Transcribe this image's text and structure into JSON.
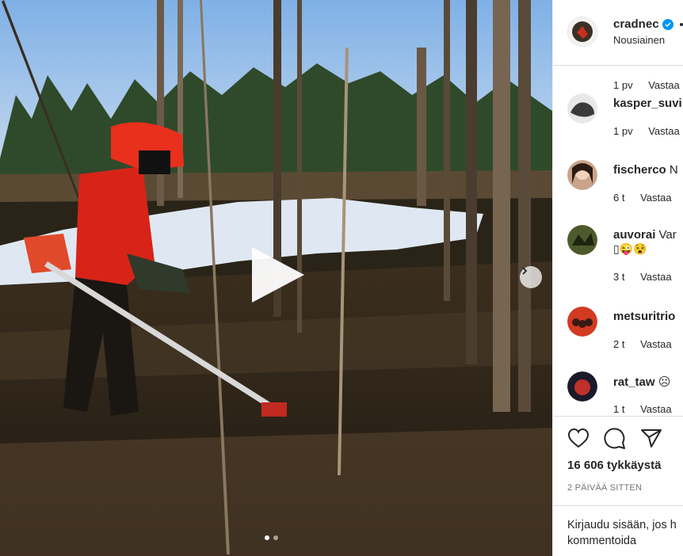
{
  "post": {
    "username": "cradnec",
    "location": "Nousiainen",
    "likes": "16 606 tykkäystä",
    "date": "2 PÄIVÄÄ SITTEN"
  },
  "comments": [
    {
      "user": "",
      "text": "",
      "time": "1 pv",
      "reply": "Vastaa"
    },
    {
      "user": "kasper_suvi",
      "text": "",
      "time": "1 pv",
      "reply": "Vastaa"
    },
    {
      "user": "fischerco",
      "text": " N",
      "time": "6 t",
      "reply": "Vastaa"
    },
    {
      "user": "auvorai",
      "text": " Var",
      "extra": "▯😜😵",
      "time": "3 t",
      "reply": "Vastaa"
    },
    {
      "user": "metsuritrio",
      "text": "",
      "time": "2 t",
      "reply": "Vastaa"
    },
    {
      "user": "rat_taw",
      "text": " ☹",
      "time": "1 t",
      "reply": "Vastaa"
    }
  ],
  "login_prompt": "Kirjaudu sisään, jos h kommentoida",
  "icons": {
    "like": "heart-icon",
    "comment": "comment-bubble-icon",
    "share": "paper-plane-icon",
    "play": "play-icon",
    "next": "chevron-right-icon",
    "verified": "verified-badge-icon"
  },
  "colors": {
    "verified": "#0095f6",
    "text": "#262626",
    "muted": "#737373",
    "border": "#dbdbdb"
  },
  "carousel": {
    "slides": 2,
    "active": 1
  }
}
